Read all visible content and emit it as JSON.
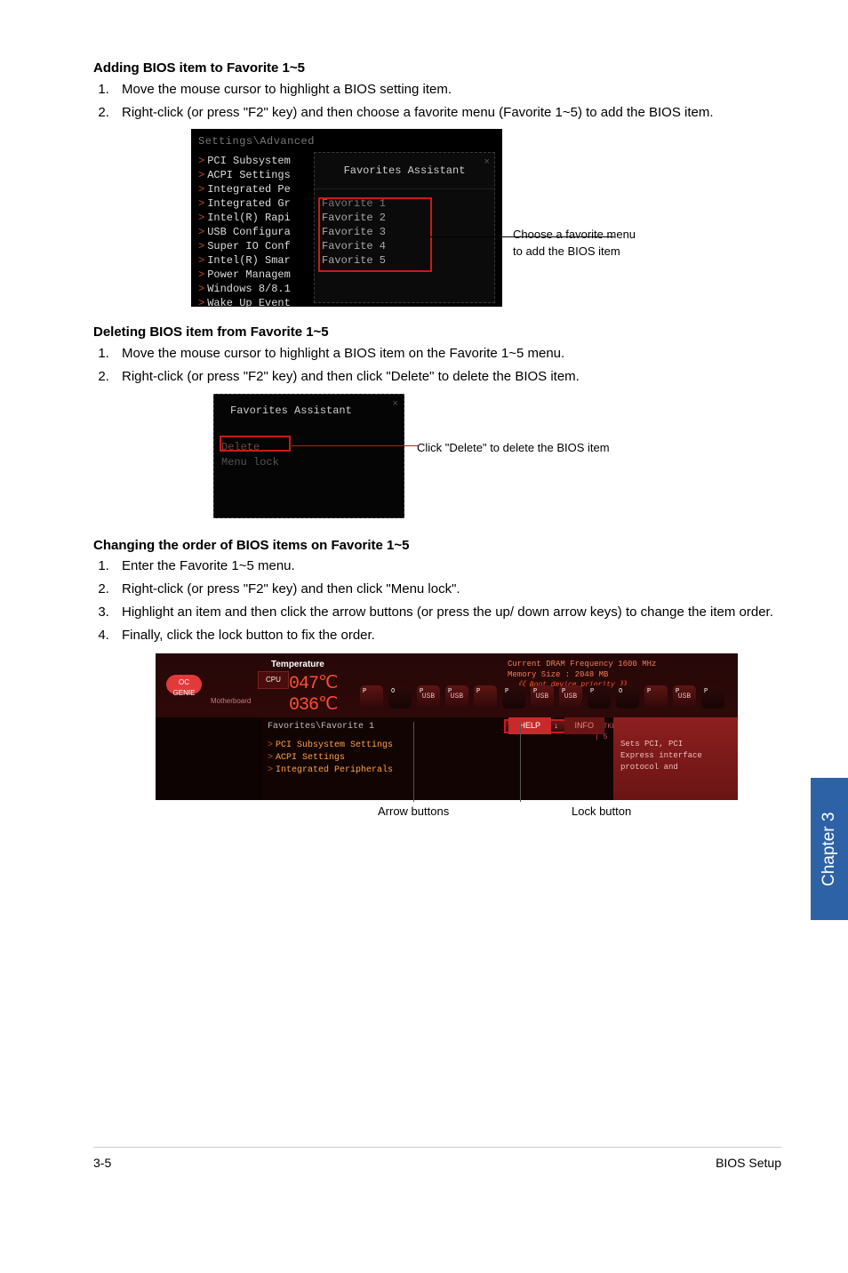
{
  "section1": {
    "title": "Adding BIOS item to Favorite 1~5",
    "steps": [
      "Move the mouse cursor to highlight a BIOS setting item.",
      "Right-click (or press \"F2\" key) and then choose a favorite menu (Favorite 1~5) to add the BIOS item."
    ]
  },
  "shot1": {
    "breadcrumb": "Settings\\Advanced",
    "left_items": [
      "PCI Subsystem",
      "ACPI Settings",
      "Integrated Pe",
      "Integrated Gr",
      "Intel(R) Rapi",
      "USB Configura",
      "Super IO Conf",
      "Intel(R) Smar",
      "Power Managem",
      "Windows 8/8.1",
      "Wake Up Event"
    ],
    "popup_title": "Favorites Assistant",
    "close": "×",
    "options": [
      "Favorite 1",
      "Favorite 2",
      "Favorite 3",
      "Favorite 4",
      "Favorite 5"
    ],
    "callout_l1": "Choose a favorite menu",
    "callout_l2": "to add the BIOS item"
  },
  "section2": {
    "title": "Deleting BIOS item from Favorite 1~5",
    "steps": [
      "Move the mouse cursor to highlight a BIOS item on the Favorite 1~5 menu.",
      "Right-click (or press \"F2\" key) and then click \"Delete\" to delete the BIOS item."
    ]
  },
  "shot2": {
    "popup_title": "Favorites Assistant",
    "close": "×",
    "delete_opt": "Delete",
    "menu_lock": "Menu lock",
    "callout": "Click \"Delete\" to delete the BIOS item"
  },
  "section3": {
    "title": "Changing the order of BIOS items on Favorite 1~5",
    "steps": [
      "Enter the Favorite 1~5 menu.",
      "Right-click (or press \"F2\" key) and then click \"Menu lock\".",
      "Highlight an item and then click the arrow buttons (or press the up/ down arrow keys) to change the item order.",
      "Finally, click the lock button to fix the order."
    ]
  },
  "shot3": {
    "oc_genie_l1": "OC",
    "oc_genie_l2": "GENIE",
    "motherboard": "Motherboard",
    "temperature_lbl": "Temperature",
    "cpu_lbl": "CPU",
    "cpu_temp": "047℃",
    "mb_temp": "036℃",
    "dram_line": "Current DRAM Frequency 1600 MHz",
    "memory_line": "Memory Size : 2048 MB",
    "boot_priority": "《《 Boot device priority 》》",
    "usb_badge": "USB",
    "breadcrumb": "Favorites\\Favorite 1",
    "mid_items": [
      "PCI Subsystem Settings",
      "ACPI Settings",
      "Integrated Peripherals"
    ],
    "arrow_left": "←",
    "arrow_up": "↑",
    "arrow_down": "↓",
    "lock_icon": "🔒",
    "hotkey": "HOTKEY | 5",
    "help": "HELP",
    "info": "INFO",
    "help_l1": "Sets PCI, PCI",
    "help_l2": "Express interface",
    "help_l3": "protocol and",
    "caption_arrow": "Arrow buttons",
    "caption_lock": "Lock button"
  },
  "chapter_tab": "Chapter 3",
  "footer": {
    "page": "3-5",
    "section": "BIOS Setup"
  }
}
